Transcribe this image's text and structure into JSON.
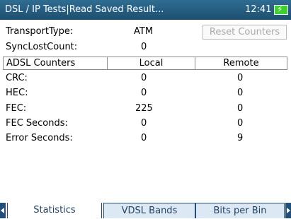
{
  "titlebar": {
    "title": "DSL / IP Tests|Read Saved Result...",
    "time": "12:41",
    "battery_icon": "battery-charging-icon"
  },
  "summary": {
    "transport_type_label": "TransportType:",
    "transport_type_value": "ATM",
    "sync_lost_label": "SyncLostCount:",
    "sync_lost_value": "0",
    "reset_button": "Reset Counters"
  },
  "counters": {
    "headers": [
      "ADSL Counters",
      "Local",
      "Remote"
    ],
    "rows": [
      {
        "label": "CRC:",
        "local": "0",
        "remote": "0"
      },
      {
        "label": "HEC:",
        "local": "0",
        "remote": "0"
      },
      {
        "label": "FEC:",
        "local": "225",
        "remote": "0"
      },
      {
        "label": "FEC Seconds:",
        "local": "0",
        "remote": "0"
      },
      {
        "label": "Error Seconds:",
        "local": "0",
        "remote": "9"
      }
    ]
  },
  "tabs": [
    {
      "label": "Statistics",
      "active": true
    },
    {
      "label": "VDSL Bands",
      "active": false
    },
    {
      "label": "Bits per Bin",
      "active": false
    }
  ],
  "colors": {
    "titlebar": "#245a7d",
    "tab_border": "#1f4f7a",
    "tab_inactive_bg": "#dce9f5",
    "battery": "#3fcf2f"
  }
}
